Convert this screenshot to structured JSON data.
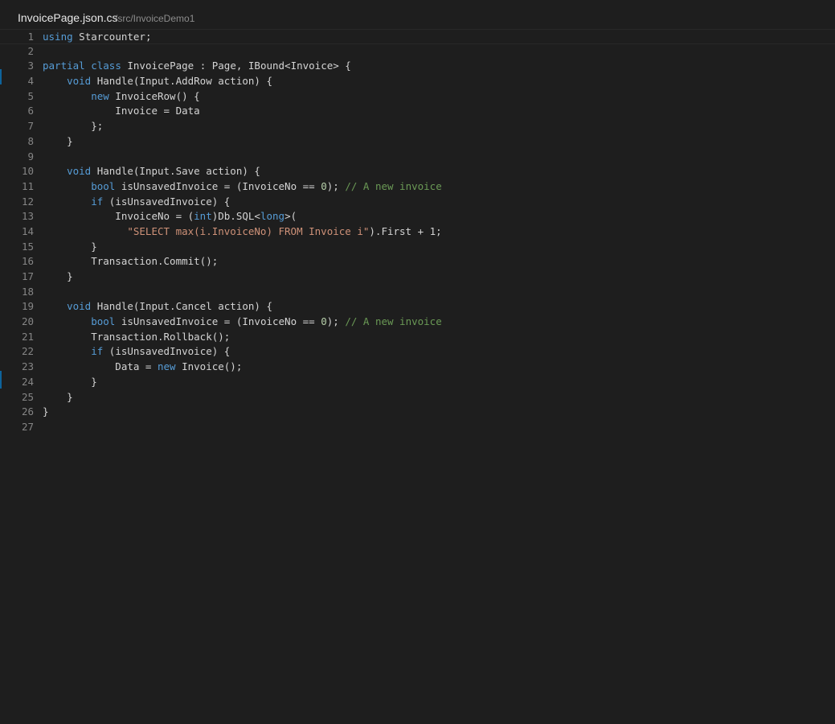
{
  "editor_tab": {
    "file_name": "InvoicePage.json.cs",
    "file_path": "/src/InvoiceDemo1"
  },
  "colors": {
    "background": "#1e1e1e",
    "keyword": "#569cd6",
    "plain": "#d4d4d4",
    "string": "#ce9178",
    "number": "#b5cea8",
    "comment": "#6a9955",
    "line_number": "#858585"
  },
  "code_lines": [
    {
      "number": "1",
      "tokens": [
        {
          "t": "kw",
          "v": "using"
        },
        {
          "t": "plain",
          "v": " Starcounter;"
        }
      ]
    },
    {
      "number": "2",
      "tokens": []
    },
    {
      "number": "3",
      "tokens": [
        {
          "t": "kw",
          "v": "partial"
        },
        {
          "t": "plain",
          "v": " "
        },
        {
          "t": "kw",
          "v": "class"
        },
        {
          "t": "plain",
          "v": " InvoicePage : Page, IBound<Invoice> {"
        }
      ]
    },
    {
      "number": "4",
      "tokens": [
        {
          "t": "plain",
          "v": "    "
        },
        {
          "t": "kw",
          "v": "void"
        },
        {
          "t": "plain",
          "v": " Handle(Input.AddRow action) {"
        }
      ]
    },
    {
      "number": "5",
      "tokens": [
        {
          "t": "plain",
          "v": "        "
        },
        {
          "t": "kw",
          "v": "new"
        },
        {
          "t": "plain",
          "v": " InvoiceRow() {"
        }
      ]
    },
    {
      "number": "6",
      "tokens": [
        {
          "t": "plain",
          "v": "            Invoice = Data"
        }
      ]
    },
    {
      "number": "7",
      "tokens": [
        {
          "t": "plain",
          "v": "        };"
        }
      ]
    },
    {
      "number": "8",
      "tokens": [
        {
          "t": "plain",
          "v": "    }"
        }
      ]
    },
    {
      "number": "9",
      "tokens": []
    },
    {
      "number": "10",
      "tokens": [
        {
          "t": "plain",
          "v": "    "
        },
        {
          "t": "kw",
          "v": "void"
        },
        {
          "t": "plain",
          "v": " Handle(Input.Save action) {"
        }
      ]
    },
    {
      "number": "11",
      "tokens": [
        {
          "t": "plain",
          "v": "        "
        },
        {
          "t": "kw",
          "v": "bool"
        },
        {
          "t": "plain",
          "v": " isUnsavedInvoice = (InvoiceNo == "
        },
        {
          "t": "num",
          "v": "0"
        },
        {
          "t": "plain",
          "v": "); "
        },
        {
          "t": "comment",
          "v": "// A new invoice"
        }
      ]
    },
    {
      "number": "12",
      "tokens": [
        {
          "t": "plain",
          "v": "        "
        },
        {
          "t": "kw",
          "v": "if"
        },
        {
          "t": "plain",
          "v": " (isUnsavedInvoice) {"
        }
      ]
    },
    {
      "number": "13",
      "tokens": [
        {
          "t": "plain",
          "v": "            InvoiceNo = ("
        },
        {
          "t": "kw",
          "v": "int"
        },
        {
          "t": "plain",
          "v": ")Db.SQL<"
        },
        {
          "t": "kw",
          "v": "long"
        },
        {
          "t": "plain",
          "v": ">("
        }
      ]
    },
    {
      "number": "14",
      "tokens": [
        {
          "t": "plain",
          "v": "              "
        },
        {
          "t": "str",
          "v": "\"SELECT max(i.InvoiceNo) FROM Invoice i\""
        },
        {
          "t": "plain",
          "v": ").First + 1;"
        }
      ]
    },
    {
      "number": "15",
      "tokens": [
        {
          "t": "plain",
          "v": "        }"
        }
      ]
    },
    {
      "number": "16",
      "tokens": [
        {
          "t": "plain",
          "v": "        Transaction.Commit();"
        }
      ]
    },
    {
      "number": "17",
      "tokens": [
        {
          "t": "plain",
          "v": "    }"
        }
      ]
    },
    {
      "number": "18",
      "tokens": []
    },
    {
      "number": "19",
      "tokens": [
        {
          "t": "plain",
          "v": "    "
        },
        {
          "t": "kw",
          "v": "void"
        },
        {
          "t": "plain",
          "v": " Handle(Input.Cancel action) {"
        }
      ]
    },
    {
      "number": "20",
      "tokens": [
        {
          "t": "plain",
          "v": "        "
        },
        {
          "t": "kw",
          "v": "bool"
        },
        {
          "t": "plain",
          "v": " isUnsavedInvoice = (InvoiceNo == "
        },
        {
          "t": "num",
          "v": "0"
        },
        {
          "t": "plain",
          "v": "); "
        },
        {
          "t": "comment",
          "v": "// A new invoice"
        }
      ]
    },
    {
      "number": "21",
      "tokens": [
        {
          "t": "plain",
          "v": "        Transaction.Rollback();"
        }
      ]
    },
    {
      "number": "22",
      "tokens": [
        {
          "t": "plain",
          "v": "        "
        },
        {
          "t": "kw",
          "v": "if"
        },
        {
          "t": "plain",
          "v": " (isUnsavedInvoice) {"
        }
      ]
    },
    {
      "number": "23",
      "tokens": [
        {
          "t": "plain",
          "v": "            Data = "
        },
        {
          "t": "kw",
          "v": "new"
        },
        {
          "t": "plain",
          "v": " Invoice();"
        }
      ]
    },
    {
      "number": "24",
      "tokens": [
        {
          "t": "plain",
          "v": "        }"
        }
      ]
    },
    {
      "number": "25",
      "tokens": [
        {
          "t": "plain",
          "v": "    }"
        }
      ]
    },
    {
      "number": "26",
      "tokens": [
        {
          "t": "plain",
          "v": "}"
        }
      ]
    },
    {
      "number": "27",
      "tokens": []
    }
  ]
}
